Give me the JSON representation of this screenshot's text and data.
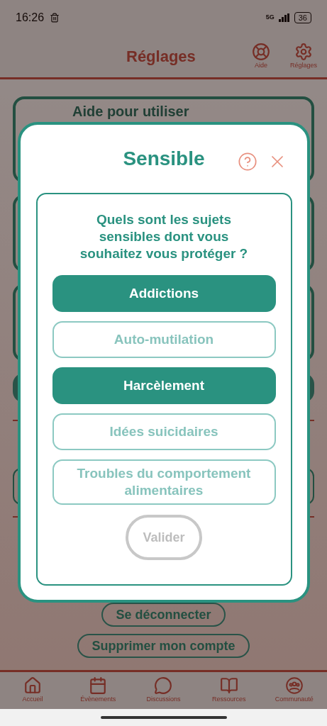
{
  "status_bar": {
    "time": "16:26",
    "network": "5G",
    "battery": "36"
  },
  "header": {
    "title": "Réglages",
    "actions": [
      {
        "label": "Aide",
        "kind": "help"
      },
      {
        "label": "Réglages",
        "kind": "settings"
      }
    ]
  },
  "background": {
    "card_title": "Aide pour utiliser",
    "buttons": [
      "Se déconnecter",
      "Supprimer mon compte"
    ]
  },
  "dialog": {
    "title": "Sensible",
    "question": "Quels sont les sujets sensibles dont vous souhaitez vous protéger ?",
    "options": [
      {
        "label": "Addictions",
        "selected": true
      },
      {
        "label": "Auto-mutilation",
        "selected": false
      },
      {
        "label": "Harcèlement",
        "selected": true
      },
      {
        "label": "Idées suicidaires",
        "selected": false
      },
      {
        "label": "Troubles du comportement alimentaires",
        "selected": false
      }
    ],
    "submit": {
      "label": "Valider",
      "disabled": true
    }
  },
  "bottom_nav": [
    {
      "label": "Accueil",
      "kind": "home"
    },
    {
      "label": "Évènements",
      "kind": "calendar"
    },
    {
      "label": "Discussions",
      "kind": "chat"
    },
    {
      "label": "Ressources",
      "kind": "book"
    },
    {
      "label": "Communauté",
      "kind": "community"
    }
  ]
}
